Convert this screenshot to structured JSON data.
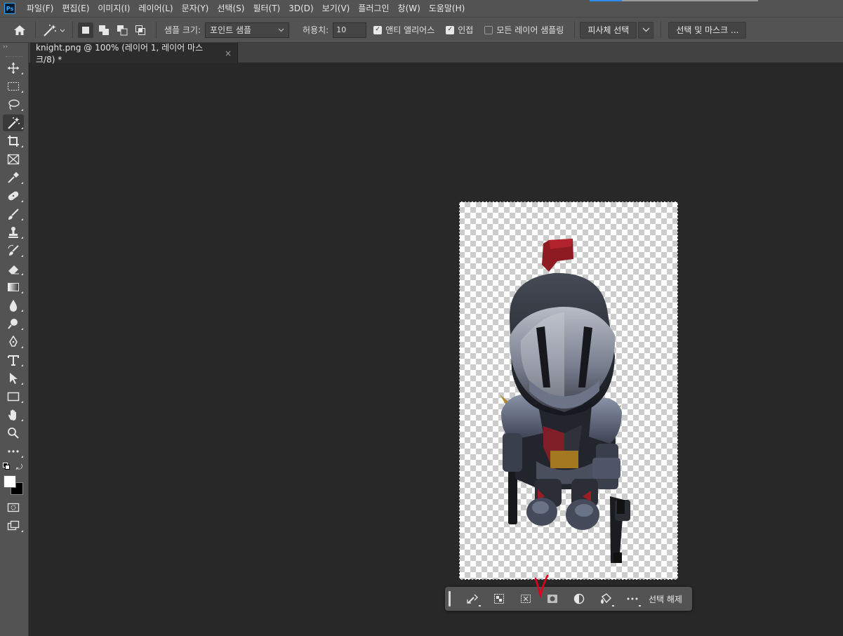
{
  "app": {
    "logo": "Ps"
  },
  "menu": [
    "파일(F)",
    "편집(E)",
    "이미지(I)",
    "레이어(L)",
    "문자(Y)",
    "선택(S)",
    "필터(T)",
    "3D(D)",
    "보기(V)",
    "플러그인",
    "창(W)",
    "도움말(H)"
  ],
  "options": {
    "sample_size_label": "샘플 크기:",
    "sample_size_value": "포인트 샘플",
    "tolerance_label": "허용치:",
    "tolerance_value": "10",
    "antialias_label": "앤티 앨리어스",
    "antialias_checked": true,
    "contiguous_label": "인접",
    "contiguous_checked": true,
    "all_layers_label": "모든 레이어 샘플링",
    "all_layers_checked": false,
    "select_subject": "피사체 선택",
    "select_and_mask": "선택 및 마스크 ..."
  },
  "document_tab": {
    "title": "knight.png @ 100% (레이어 1, 레이어 마스크/8) *",
    "close": "×"
  },
  "tools": [
    "move-tool",
    "marquee-tool",
    "lasso-tool",
    "magic-wand-tool",
    "crop-tool",
    "frame-tool",
    "eyedropper-tool",
    "healing-brush-tool",
    "brush-tool",
    "clone-stamp-tool",
    "history-brush-tool",
    "eraser-tool",
    "gradient-tool",
    "blur-tool",
    "dodge-tool",
    "pen-tool",
    "type-tool",
    "path-selection-tool",
    "rectangle-tool",
    "hand-tool",
    "zoom-tool",
    "more-tools"
  ],
  "active_tool": "magic-wand-tool",
  "colors": {
    "foreground": "#ffffff",
    "background": "#000000",
    "accent": "#31a8ff",
    "annotation": "#e0001b"
  },
  "taskbar": {
    "buttons": [
      "select-subject-icon",
      "transform-selection-icon",
      "invert-selection-icon",
      "create-mask-icon",
      "adjustment-layer-icon",
      "fill-selection-icon",
      "more-options-icon"
    ],
    "deselect": "선택 해제"
  },
  "annotation_mark": "√"
}
